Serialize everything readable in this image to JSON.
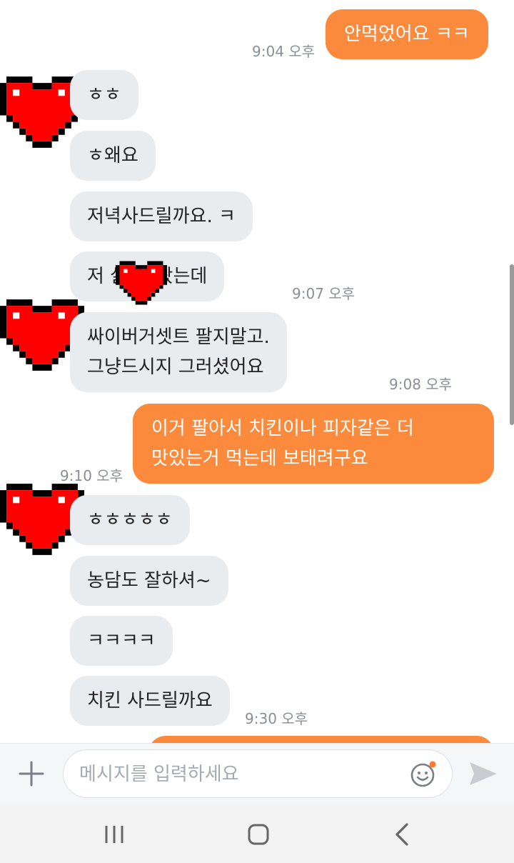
{
  "messages": [
    {
      "side": "out",
      "text": "안먹었어요 ㅋㅋ",
      "time": "9:04 오후"
    },
    {
      "side": "in",
      "text": "ㅎㅎ"
    },
    {
      "side": "in",
      "text": "ㅎ왜요"
    },
    {
      "side": "in",
      "text": "저녁사드릴까요. ㅋ"
    },
    {
      "side": "in",
      "text": "저       살다. 왔는데",
      "time": "9:07 오후"
    },
    {
      "side": "in",
      "line1": "싸이버거셋트 팔지말고.",
      "line2": "그냥드시지 그러셨어요",
      "time": "9:08 오후"
    },
    {
      "side": "out",
      "line1": "이거 팔아서 치킨이나 피자같은 더",
      "line2": "맛있는거 먹는데 보태려구요",
      "time": "9:10 오후"
    },
    {
      "side": "in",
      "text": "ㅎㅎㅎㅎㅎ"
    },
    {
      "side": "in",
      "text": "농담도 잘하셔~"
    },
    {
      "side": "in",
      "text": "ㅋㅋㅋㅋ"
    },
    {
      "side": "in",
      "text": "치킨 사드릴까요",
      "time": "9:30 오후"
    }
  ],
  "input": {
    "placeholder": "메시지를 입력하세요",
    "value": ""
  },
  "icons": {
    "plus": "plus-icon",
    "emoji": "emoji-icon",
    "send": "send-icon",
    "avatar": "pixel-heart-avatar",
    "nav_recent": "recent-apps-icon",
    "nav_home": "home-icon",
    "nav_back": "back-icon"
  },
  "colors": {
    "outgoing_bubble": "#fb8a3c",
    "incoming_bubble": "#e9ecef",
    "timestamp": "#8a8f95",
    "heart_red": "#ff0000",
    "emoji_dot": "#ff7a2c"
  }
}
